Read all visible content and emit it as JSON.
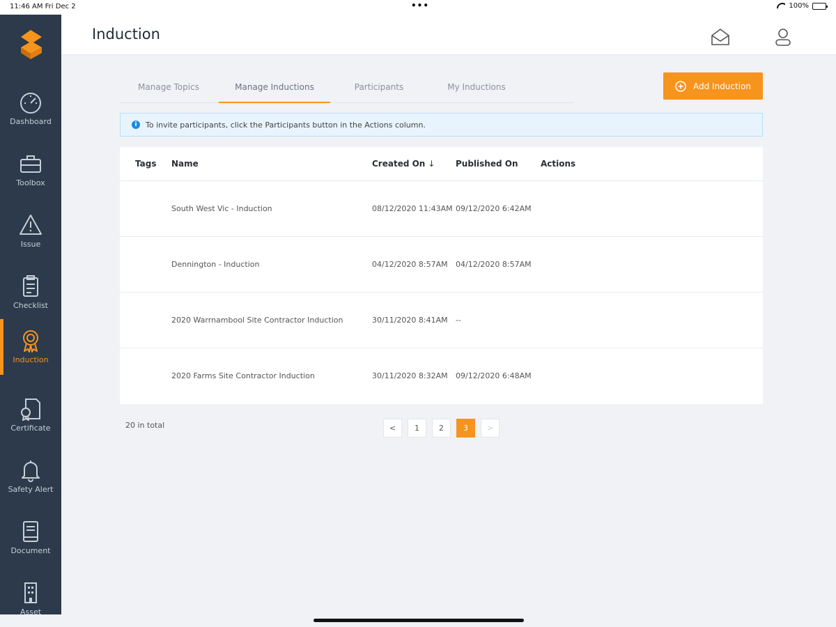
{
  "status_bar": {
    "time": "11:46 AM  Fri Dec 2",
    "dots": "•••",
    "battery": "100%"
  },
  "sidebar": {
    "items": [
      {
        "label": "Dashboard",
        "icon": "gauge-icon"
      },
      {
        "label": "Toolbox",
        "icon": "toolbox-icon"
      },
      {
        "label": "Issue",
        "icon": "warning-icon"
      },
      {
        "label": "Checklist",
        "icon": "clipboard-icon"
      },
      {
        "label": "Induction",
        "icon": "award-icon",
        "active": true
      },
      {
        "label": "Certificate",
        "icon": "certificate-icon"
      },
      {
        "label": "Safety Alert",
        "icon": "bell-icon"
      },
      {
        "label": "Document",
        "icon": "book-icon"
      },
      {
        "label": "Asset",
        "icon": "building-icon"
      }
    ]
  },
  "header": {
    "title": "Induction"
  },
  "tabs": [
    {
      "label": "Manage Topics"
    },
    {
      "label": "Manage Inductions",
      "active": true
    },
    {
      "label": "Participants"
    },
    {
      "label": "My Inductions"
    }
  ],
  "add_button": {
    "label": "Add Induction"
  },
  "info": {
    "text": "To invite participants, click the Participants button in the Actions column."
  },
  "table": {
    "headers": {
      "tags": "Tags",
      "name": "Name",
      "created": "Created On",
      "sort": "↓",
      "published": "Published On",
      "actions": "Actions"
    },
    "rows": [
      {
        "tags": "",
        "name": "South West Vic - Induction",
        "created": "08/12/2020 11:43AM",
        "published": "09/12/2020 6:42AM"
      },
      {
        "tags": "",
        "name": "Dennington - Induction",
        "created": "04/12/2020 8:57AM",
        "published": "04/12/2020 8:57AM"
      },
      {
        "tags": "",
        "name": "2020 Warrnambool Site Contractor Induction",
        "created": "30/11/2020 8:41AM",
        "published": "--"
      },
      {
        "tags": "",
        "name": "2020 Farms Site Contractor Induction",
        "created": "30/11/2020 8:32AM",
        "published": "09/12/2020 6:48AM"
      }
    ]
  },
  "pagination": {
    "total": "20 in total",
    "prev": "<",
    "pages": [
      "1",
      "2",
      "3"
    ],
    "current": "3",
    "next": ">"
  },
  "colors": {
    "accent": "#f7941d",
    "sidebar": "#2c3a4b",
    "info": "#1a8ce0"
  }
}
